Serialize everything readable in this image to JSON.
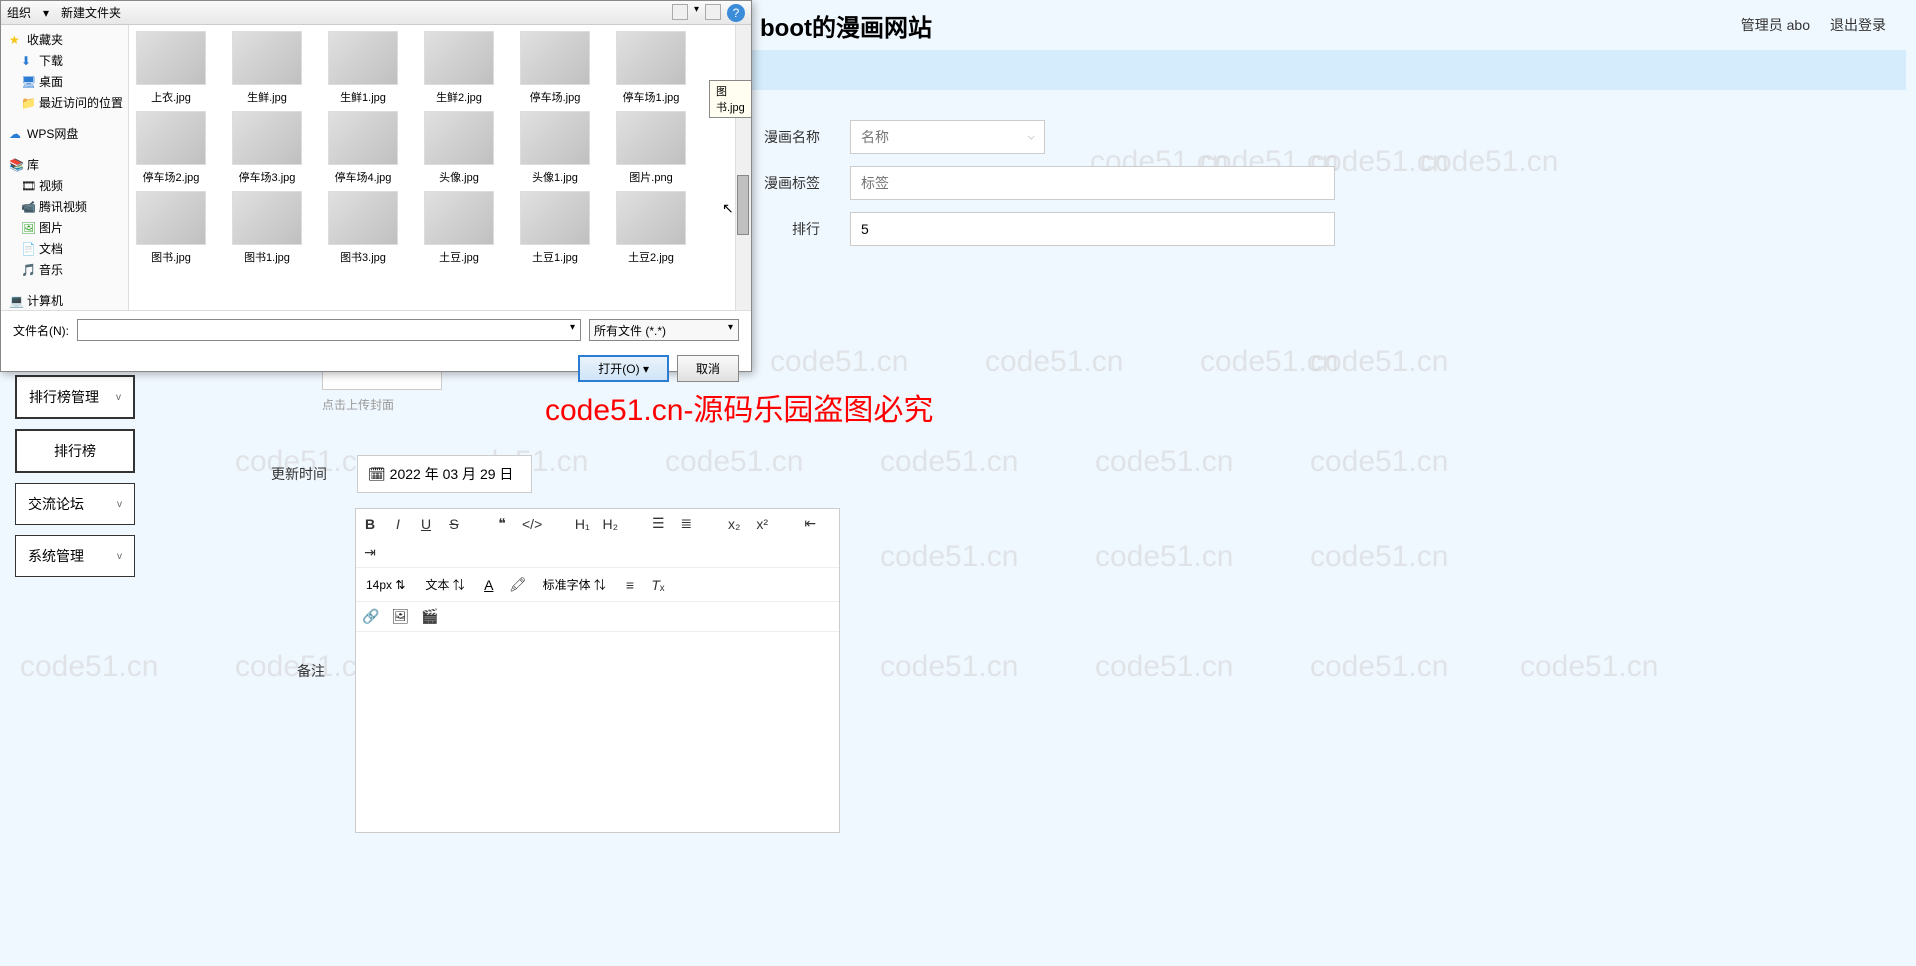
{
  "header": {
    "title_partial": "boot的漫画网站",
    "admin_label": "管理员 abo",
    "logout": "退出登录"
  },
  "sidebar": {
    "items": [
      {
        "label": "排行榜管理",
        "expandable": true
      },
      {
        "label": "排行榜",
        "expandable": false
      },
      {
        "label": "交流论坛",
        "expandable": true
      },
      {
        "label": "系统管理",
        "expandable": true
      }
    ]
  },
  "form": {
    "name_label": "漫画名称",
    "name_placeholder": "名称",
    "tag_label": "漫画标签",
    "tag_placeholder": "标签",
    "rank_label": "排行",
    "rank_value": "5",
    "upload_hint": "点击上传封面",
    "date_label": "更新时间",
    "date_value": "2022 年 03 月 29 日",
    "remark_label": "备注"
  },
  "editor": {
    "font_size": "14px",
    "style_sel": "文本",
    "font_family": "标准字体"
  },
  "red_watermark": "code51.cn-源码乐园盗图必究",
  "watermark_text": "code51.cn",
  "file_dialog": {
    "toolbar": {
      "organize": "组织",
      "new_folder": "新建文件夹"
    },
    "sidebar": {
      "favorites": "收藏夹",
      "downloads": "下载",
      "desktop": "桌面",
      "recent": "最近访问的位置",
      "wps": "WPS网盘",
      "library": "库",
      "video": "视频",
      "tencent": "腾讯视频",
      "pictures": "图片",
      "documents": "文档",
      "music": "音乐",
      "computer": "计算机"
    },
    "files": [
      "上衣.jpg",
      "生鲜.jpg",
      "生鲜1.jpg",
      "生鲜2.jpg",
      "停车场.jpg",
      "停车场1.jpg",
      "停车场2.jpg",
      "停车场3.jpg",
      "停车场4.jpg",
      "头像.jpg",
      "头像1.jpg",
      "图片.png",
      "图书.jpg",
      "图书1.jpg",
      "图书3.jpg",
      "土豆.jpg",
      "土豆1.jpg",
      "土豆2.jpg"
    ],
    "tooltip": "图书.jpg",
    "filename_label": "文件名(N):",
    "filetype": "所有文件 (*.*)",
    "open_btn": "打开(O)",
    "cancel_btn": "取消"
  }
}
